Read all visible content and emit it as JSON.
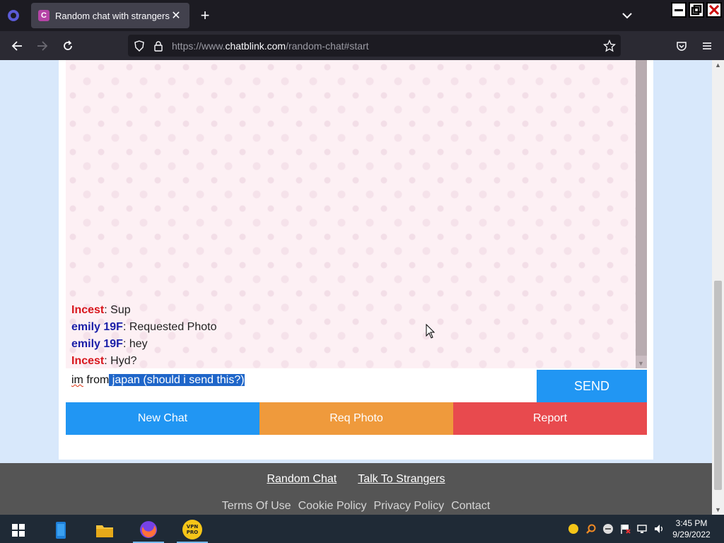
{
  "browser": {
    "tab_title": "Random chat with strangers",
    "tab_favicon_letter": "C",
    "url_prefix": "https://www.",
    "url_host": "chatblink.com",
    "url_path": "/random-chat#start"
  },
  "chat": {
    "messages": [
      {
        "nick": "Incest",
        "text": ": Sup"
      },
      {
        "nick": "emily 19F",
        "text": ": Requested Photo"
      },
      {
        "nick": "emily 19F",
        "text": ": hey"
      },
      {
        "nick": "Incest",
        "text": ": Hyd?"
      }
    ],
    "input": {
      "word_misspelled": "im",
      "plain_text": " from",
      "selected_text": " japan (should i send this?)"
    },
    "send_label": "SEND"
  },
  "actions": {
    "new_chat": "New Chat",
    "req_photo": "Req Photo",
    "report": "Report"
  },
  "footer": {
    "main_links": [
      "Random Chat",
      "Talk To Strangers"
    ],
    "sub_links": [
      "Terms Of Use",
      "Cookie Policy",
      "Privacy Policy",
      "Contact"
    ]
  },
  "taskbar": {
    "time": "3:45 PM",
    "date": "9/29/2022",
    "vpn_label": "VPN PRO"
  },
  "colors": {
    "nick_red": "#d8161c",
    "nick_blue": "#1b1fa8",
    "send_blue": "#2196f3",
    "req_orange": "#ef9a3c",
    "report_red": "#e84a4e"
  }
}
